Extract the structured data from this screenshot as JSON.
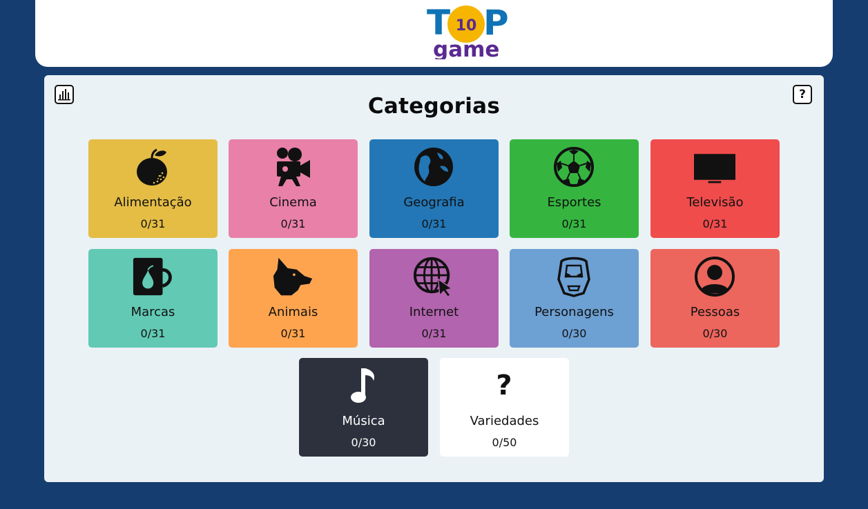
{
  "logo": {
    "top": "T",
    "p": "P",
    "badge": "10",
    "game": "game"
  },
  "header": {
    "help_label": "?"
  },
  "title": "Categorias",
  "colors": {
    "background": "#163d70",
    "panel": "#eaf2f6",
    "logo_blue": "#0f73b6",
    "logo_yellow": "#f6b500",
    "logo_purple": "#5a2a91"
  },
  "categories": [
    {
      "name": "Alimentação",
      "progress": "0/31",
      "icon": "apple-icon",
      "color": "#e5bd45"
    },
    {
      "name": "Cinema",
      "progress": "0/31",
      "icon": "movie-camera-icon",
      "color": "#e880a7"
    },
    {
      "name": "Geografia",
      "progress": "0/31",
      "icon": "globe-icon",
      "color": "#2377b6"
    },
    {
      "name": "Esportes",
      "progress": "0/31",
      "icon": "soccer-ball-icon",
      "color": "#35b540"
    },
    {
      "name": "Televisão",
      "progress": "0/31",
      "icon": "television-icon",
      "color": "#f04c4c"
    },
    {
      "name": "Marcas",
      "progress": "0/31",
      "icon": "mug-icon",
      "color": "#62c9b4"
    },
    {
      "name": "Animais",
      "progress": "0/31",
      "icon": "dog-icon",
      "color": "#fea44f"
    },
    {
      "name": "Internet",
      "progress": "0/31",
      "icon": "web-cursor-icon",
      "color": "#b264ae"
    },
    {
      "name": "Personagens",
      "progress": "0/30",
      "icon": "iron-mask-icon",
      "color": "#6da0d3"
    },
    {
      "name": "Pessoas",
      "progress": "0/30",
      "icon": "person-icon",
      "color": "#ec665d"
    },
    {
      "name": "Música",
      "progress": "0/30",
      "icon": "music-note-icon",
      "color": "#2d313d"
    },
    {
      "name": "Variedades",
      "progress": "0/50",
      "icon": "question-icon",
      "color": "#ffffff",
      "glyph": "?"
    }
  ]
}
